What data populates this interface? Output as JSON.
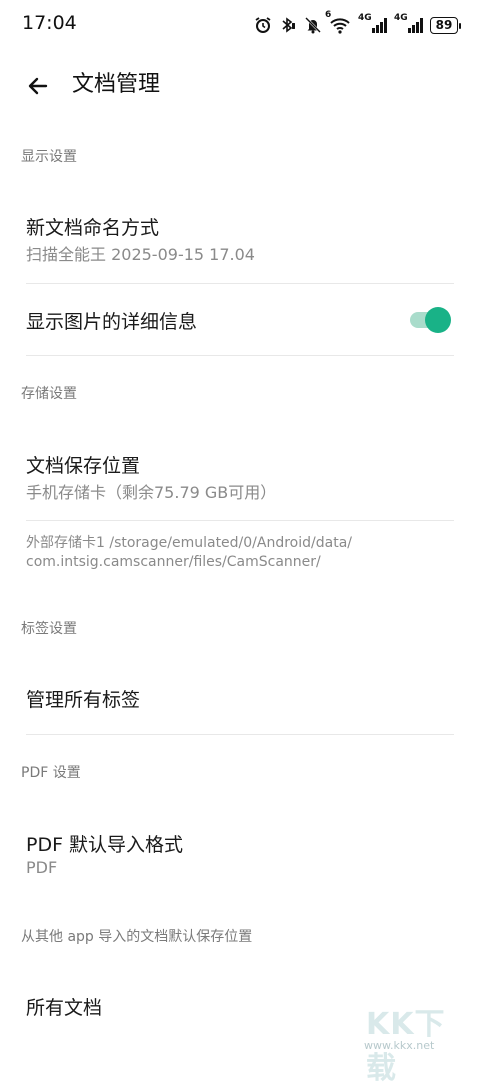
{
  "status_bar": {
    "time": "17:04",
    "icons": [
      "alarm-icon",
      "bluetooth-icon",
      "vibrate-icon",
      "mute-icon",
      "wifi-icon",
      "signal-4g-icon",
      "signal-4g-icon"
    ],
    "network_1": "4G",
    "network_2": "4G",
    "wifi_badge": "6",
    "battery": "89"
  },
  "toolbar": {
    "back_icon": "arrow-left-icon",
    "title": "文档管理"
  },
  "sections": {
    "display": {
      "header": "显示设置",
      "new_doc_naming": {
        "title": "新文档命名方式",
        "value": "扫描全能王 2025-09-15 17.04"
      },
      "show_image_details": {
        "title": "显示图片的详细信息",
        "enabled": true
      }
    },
    "storage": {
      "header": "存储设置",
      "save_location": {
        "title": "文档保存位置",
        "value": "手机存储卡（剩余75.79 GB可用）"
      },
      "path_line1": "外部存储卡1 /storage/emulated/0/Android/data/",
      "path_line2": "com.intsig.camscanner/files/CamScanner/"
    },
    "tags": {
      "header": "标签设置",
      "manage_tags": {
        "title": "管理所有标签"
      }
    },
    "pdf": {
      "header": "PDF 设置",
      "default_import": {
        "title": "PDF 默认导入格式",
        "value": "PDF"
      }
    },
    "import": {
      "header": "从其他 app 导入的文档默认保存位置",
      "all_docs": {
        "title": "所有文档"
      }
    }
  },
  "colors": {
    "accent": "#19b287",
    "accent_track": "#a9dccb",
    "section_header": "#7a7a7a",
    "secondary_text": "#8a8a8a"
  },
  "watermark": {
    "text": "KK下载",
    "url": "www.kkx.net"
  }
}
